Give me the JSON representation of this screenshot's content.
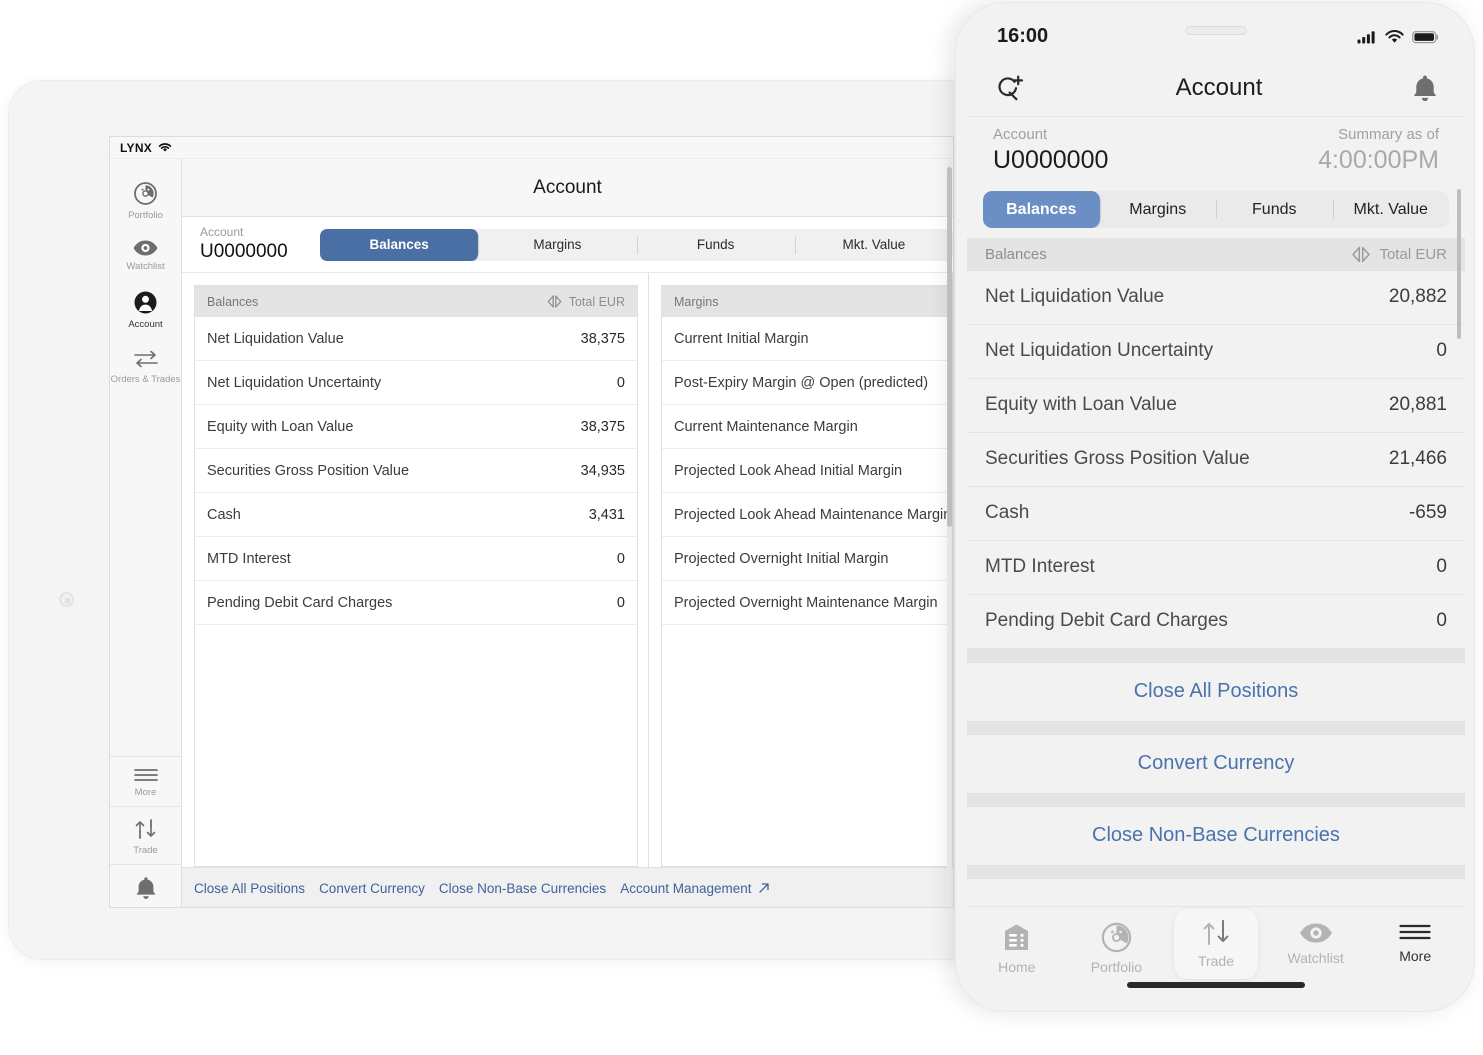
{
  "colors": {
    "accent_tablet": "#4a6fa5",
    "accent_phone": "#6b8ec4",
    "link_blue": "#3f6399",
    "phone_link_blue": "#4a72ad",
    "header_grey": "#e4e4e4"
  },
  "tablet": {
    "status": {
      "brand": "LYNX",
      "wifi_icon": "wifi-icon"
    },
    "sidebar": {
      "top_items": [
        {
          "label": "Portfolio",
          "icon": "portfolio-icon",
          "active": false
        },
        {
          "label": "Watchlist",
          "icon": "eye-icon",
          "active": false
        },
        {
          "label": "Account",
          "icon": "account-person-icon",
          "active": true
        },
        {
          "label": "Orders & Trades",
          "icon": "arrows-horizontal-icon",
          "active": false
        }
      ],
      "bottom_items": [
        {
          "label": "More",
          "icon": "hamburger-icon"
        },
        {
          "label": "Trade",
          "icon": "trade-arrows-icon"
        },
        {
          "label": "",
          "icon": "bell-icon"
        }
      ]
    },
    "title": "Account",
    "account": {
      "label": "Account",
      "value": "U0000000"
    },
    "tabs": [
      {
        "label": "Balances",
        "active": true
      },
      {
        "label": "Margins",
        "active": false
      },
      {
        "label": "Funds",
        "active": false
      },
      {
        "label": "Mkt. Value",
        "active": false
      }
    ],
    "balances_panel": {
      "header": "Balances",
      "currency_label": "Total EUR",
      "currency_icon": "currency-switch-icon",
      "rows": [
        {
          "label": "Net Liquidation Value",
          "value": "38,375"
        },
        {
          "label": "Net Liquidation Uncertainty",
          "value": "0"
        },
        {
          "label": "Equity with Loan Value",
          "value": "38,375"
        },
        {
          "label": "Securities Gross Position Value",
          "value": "34,935"
        },
        {
          "label": "Cash",
          "value": "3,431"
        },
        {
          "label": "MTD Interest",
          "value": "0"
        },
        {
          "label": "Pending Debit Card Charges",
          "value": "0"
        }
      ]
    },
    "margins_panel": {
      "header": "Margins",
      "rows": [
        {
          "label": "Current Initial Margin",
          "value": ""
        },
        {
          "label": "Post-Expiry Margin @ Open (predicted)",
          "value": ""
        },
        {
          "label": "Current Maintenance Margin",
          "value": ""
        },
        {
          "label": "Projected Look Ahead Initial Margin",
          "value": ""
        },
        {
          "label": "Projected Look Ahead Maintenance Margin",
          "value": ""
        },
        {
          "label": "Projected Overnight Initial Margin",
          "value": ""
        },
        {
          "label": "Projected Overnight Maintenance Margin",
          "value": ""
        }
      ]
    },
    "footer_links": [
      {
        "label": "Close All Positions",
        "external": false
      },
      {
        "label": "Convert Currency",
        "external": false
      },
      {
        "label": "Close Non-Base Currencies",
        "external": false
      },
      {
        "label": "Account Management",
        "external": true,
        "icon": "external-link-icon"
      }
    ]
  },
  "phone": {
    "status": {
      "time": "16:00",
      "signal_icon": "cellular-signal-icon",
      "wifi_icon": "wifi-icon",
      "battery_icon": "battery-full-icon"
    },
    "header": {
      "left_icon": "search-add-icon",
      "title": "Account",
      "right_icon": "bell-icon"
    },
    "account": {
      "label": "Account",
      "value": "U0000000",
      "summary_label": "Summary as of",
      "summary_time": "4:00:00PM"
    },
    "tabs": [
      {
        "label": "Balances",
        "active": true
      },
      {
        "label": "Margins",
        "active": false
      },
      {
        "label": "Funds",
        "active": false
      },
      {
        "label": "Mkt. Value",
        "active": false
      }
    ],
    "section": {
      "header": "Balances",
      "currency_label": "Total EUR",
      "currency_icon": "currency-switch-icon"
    },
    "rows": [
      {
        "label": "Net Liquidation Value",
        "value": "20,882"
      },
      {
        "label": "Net Liquidation Uncertainty",
        "value": "0"
      },
      {
        "label": "Equity with Loan Value",
        "value": "20,881"
      },
      {
        "label": "Securities Gross Position Value",
        "value": "21,466"
      },
      {
        "label": "Cash",
        "value": "-659"
      },
      {
        "label": "MTD Interest",
        "value": "0"
      },
      {
        "label": "Pending Debit Card Charges",
        "value": "0"
      }
    ],
    "actions": [
      {
        "label": "Close All Positions"
      },
      {
        "label": "Convert Currency"
      },
      {
        "label": "Close Non-Base Currencies"
      }
    ],
    "tabbar": [
      {
        "label": "Home",
        "icon": "home-icon",
        "active": false,
        "elevated": false
      },
      {
        "label": "Portfolio",
        "icon": "portfolio-icon",
        "active": false,
        "elevated": false
      },
      {
        "label": "Trade",
        "icon": "trade-arrows-icon",
        "active": false,
        "elevated": true
      },
      {
        "label": "Watchlist",
        "icon": "eye-icon",
        "active": false,
        "elevated": false
      },
      {
        "label": "More",
        "icon": "hamburger-icon",
        "active": true,
        "elevated": false
      }
    ]
  }
}
